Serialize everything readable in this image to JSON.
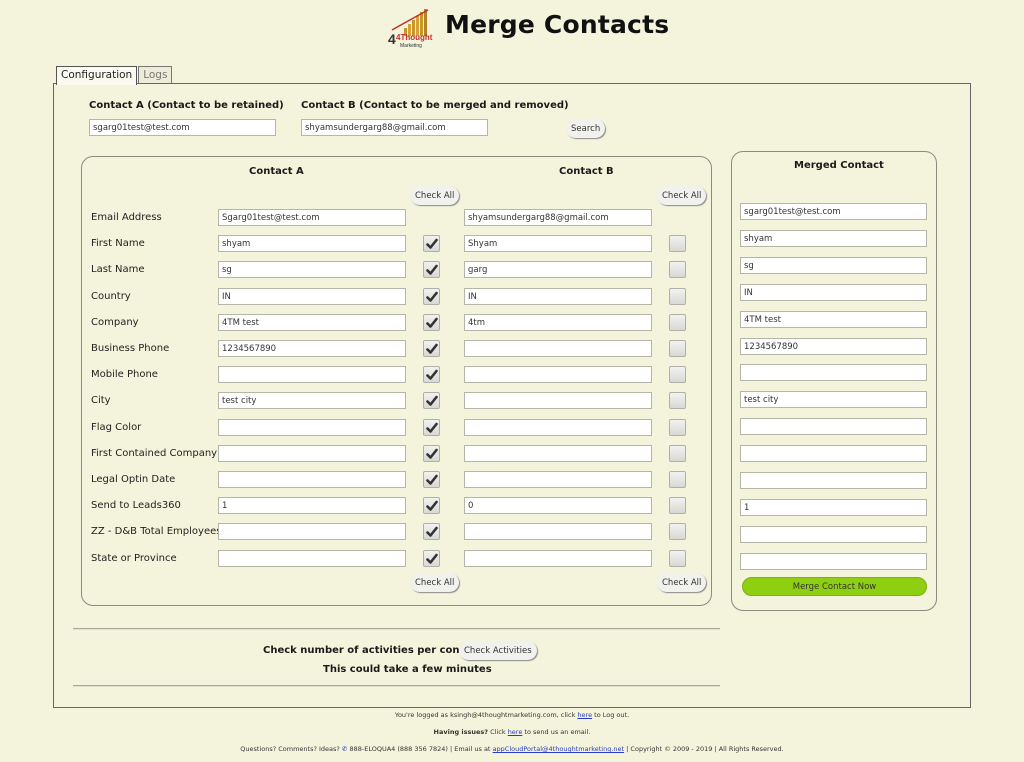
{
  "header": {
    "title": "Merge Contacts",
    "logo": {
      "line1": "4Thought",
      "line2": "Marketing"
    }
  },
  "tabs": [
    {
      "label": "Configuration",
      "active": true
    },
    {
      "label": "Logs",
      "active": false
    }
  ],
  "search": {
    "contact_a_label": "Contact A (Contact to be retained)",
    "contact_a_value": "sgarg01test@test.com",
    "contact_b_label": "Contact B (Contact to be merged and removed)",
    "contact_b_value": "shyamsundergarg88@gmail.com",
    "search_button": "Search"
  },
  "compare": {
    "contact_a_header": "Contact A",
    "contact_b_header": "Contact B",
    "check_all_label": "Check All",
    "rows": [
      {
        "label": "Email Address",
        "a": "Sgarg01test@test.com",
        "a_checked": null,
        "b": "shyamsundergarg88@gmail.com",
        "b_checked": null
      },
      {
        "label": "First Name",
        "a": "shyam",
        "a_checked": true,
        "b": "Shyam",
        "b_checked": false
      },
      {
        "label": "Last Name",
        "a": "sg",
        "a_checked": true,
        "b": "garg",
        "b_checked": false
      },
      {
        "label": "Country",
        "a": "IN",
        "a_checked": true,
        "b": "IN",
        "b_checked": false
      },
      {
        "label": "Company",
        "a": "4TM test",
        "a_checked": true,
        "b": "4tm",
        "b_checked": false
      },
      {
        "label": "Business Phone",
        "a": "1234567890",
        "a_checked": true,
        "b": "",
        "b_checked": false
      },
      {
        "label": "Mobile Phone",
        "a": "",
        "a_checked": true,
        "b": "",
        "b_checked": false
      },
      {
        "label": "City",
        "a": "test city",
        "a_checked": true,
        "b": "",
        "b_checked": false
      },
      {
        "label": "Flag Color",
        "a": "",
        "a_checked": true,
        "b": "",
        "b_checked": false
      },
      {
        "label": "First Contained Company",
        "a": "",
        "a_checked": true,
        "b": "",
        "b_checked": false
      },
      {
        "label": "Legal Optin Date",
        "a": "",
        "a_checked": true,
        "b": "",
        "b_checked": false
      },
      {
        "label": "Send to Leads360",
        "a": "1",
        "a_checked": true,
        "b": "0",
        "b_checked": false
      },
      {
        "label": "ZZ - D&B Total Employees",
        "a": "",
        "a_checked": true,
        "b": "",
        "b_checked": false
      },
      {
        "label": "State or Province",
        "a": "",
        "a_checked": true,
        "b": "",
        "b_checked": false
      }
    ]
  },
  "merged": {
    "header": "Merged Contact",
    "values": [
      "sgarg01test@test.com",
      "shyam",
      "sg",
      "IN",
      "4TM test",
      "1234567890",
      "",
      "test city",
      "",
      "",
      "",
      "1",
      "",
      ""
    ],
    "merge_button": "Merge Contact Now",
    "merge_button_color": "#8fcf12"
  },
  "activities": {
    "prompt": "Check number of activities per contact",
    "button": "Check Activities",
    "note": "This could take a few minutes"
  },
  "footer": {
    "logged_pre": "You're logged as ksingh@4thoughtmarketing.com, click",
    "logged_link": "here",
    "logged_post": "to Log out.",
    "issues_bold": "Having issues?",
    "issues_pre": "Click",
    "issues_link": "here",
    "issues_post": "to send us an email.",
    "contact_pre": "Questions? Comments? Ideas?",
    "phone": "888-ELOQUA4 (888 356 7824)",
    "email_pre": "| Email us at",
    "email_link": "appCloudPortal@4thoughtmarketing.net",
    "copyright": "| Copyright © 2009 - 2019 | All Rights Reserved."
  }
}
